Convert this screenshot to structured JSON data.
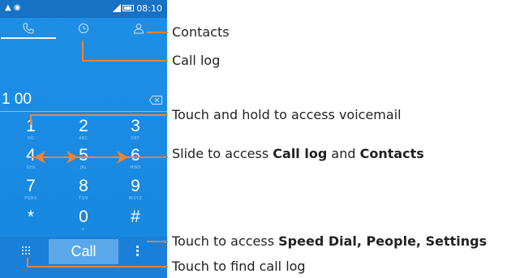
{
  "status_bar": {
    "time": "08:10",
    "left_icons": "▲ ◉"
  },
  "tabs": [
    {
      "name": "dialer",
      "icon": "phone-icon",
      "active": true
    },
    {
      "name": "call-log",
      "icon": "clock-icon",
      "active": false
    },
    {
      "name": "contacts",
      "icon": "person-icon",
      "active": false
    }
  ],
  "dial_number": "1 00",
  "keypad": [
    {
      "digit": "1",
      "letters": "OO"
    },
    {
      "digit": "2",
      "letters": "ABC"
    },
    {
      "digit": "3",
      "letters": "DEF"
    },
    {
      "digit": "4",
      "letters": "GHI"
    },
    {
      "digit": "5",
      "letters": "JKL"
    },
    {
      "digit": "6",
      "letters": "MNO"
    },
    {
      "digit": "7",
      "letters": "PQRS"
    },
    {
      "digit": "8",
      "letters": "TUV"
    },
    {
      "digit": "9",
      "letters": "WXYZ"
    },
    {
      "digit": "*",
      "letters": ""
    },
    {
      "digit": "0",
      "letters": "+"
    },
    {
      "digit": "#",
      "letters": ""
    }
  ],
  "call_button": "Call",
  "callouts": {
    "contacts": "Contacts",
    "call_log": "Call log",
    "voicemail": "Touch and hold to access voicemail",
    "slide_prefix": "Slide to access ",
    "slide_call_log": "Call log",
    "slide_and": " and ",
    "slide_contacts": "Contacts",
    "menu_prefix": "Touch to access ",
    "menu_bold": "Speed Dial, People, Settings",
    "find_log": "Touch to find call log"
  },
  "colors": {
    "phone_bg": "#1f8fe6",
    "status_bar": "#1672c4",
    "call_button": "#5aa8ea",
    "callout_line": "#f08436"
  }
}
